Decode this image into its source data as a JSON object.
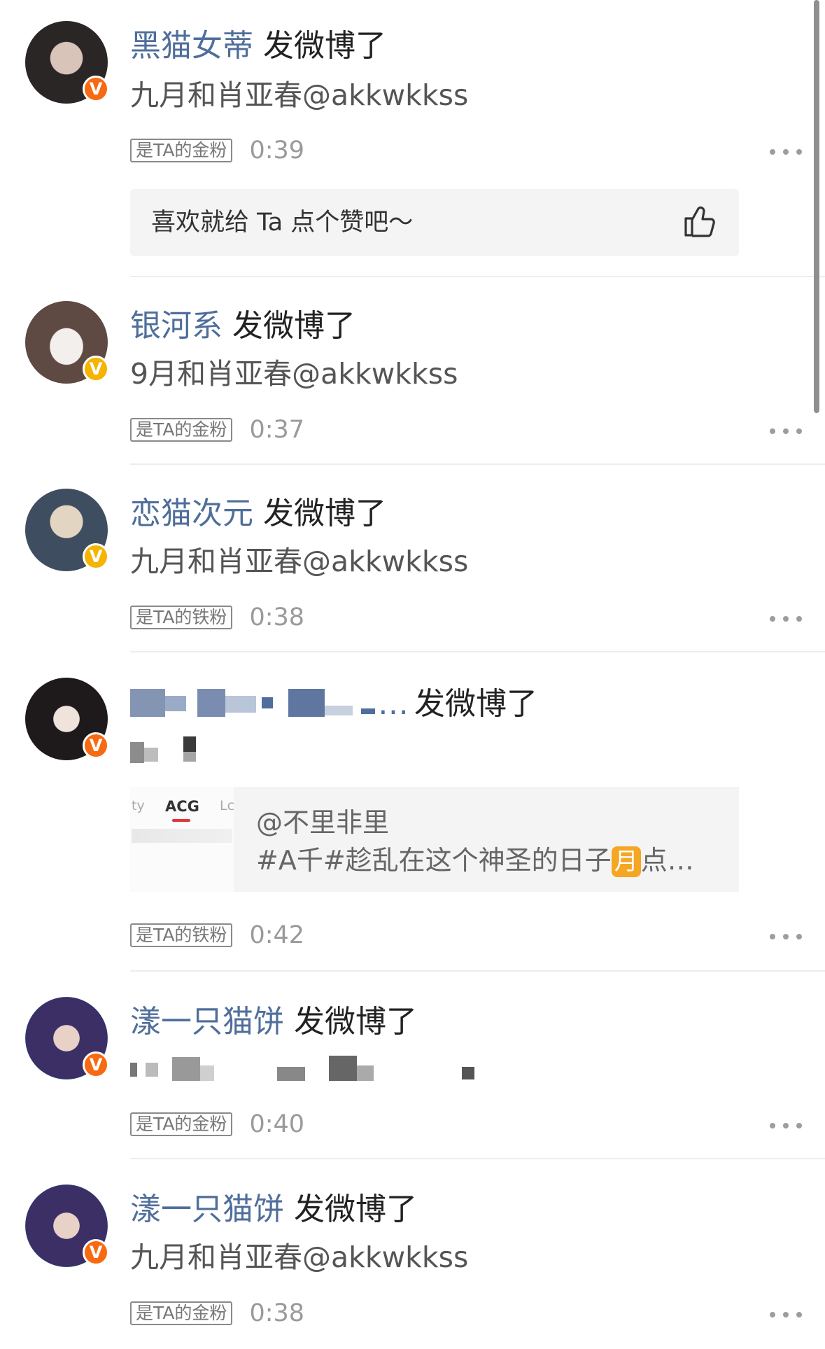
{
  "feed": {
    "items": [
      {
        "username": "黑猫女蒂",
        "action": "发微博了",
        "text": "九月和肖亚春@akkwkkss",
        "fan_tag": "是TA的金粉",
        "time": "0:39",
        "badge": "v",
        "like_prompt": "喜欢就给 Ta 点个赞吧～"
      },
      {
        "username": "银河系",
        "action": "发微博了",
        "text": "9月和肖亚春@akkwkkss",
        "fan_tag": "是TA的金粉",
        "time": "0:37",
        "badge": "v"
      },
      {
        "username": "恋猫次元",
        "action": "发微博了",
        "text": "九月和肖亚春@akkwkkss",
        "fan_tag": "是TA的铁粉",
        "time": "0:38",
        "badge": "v"
      },
      {
        "username_suffix": "…",
        "action": "发微博了",
        "fan_tag": "是TA的铁粉",
        "time": "0:42",
        "badge": "v",
        "repost": {
          "thumb_tab_left": "ty",
          "thumb_tab_active": "ACG",
          "thumb_tab_right": "Lc",
          "mention": "@不里非里",
          "snippet_before": "#A千#趁乱在这个神圣的日子",
          "snippet_emoji": "月",
          "snippet_after": "点…"
        }
      },
      {
        "username": "漾一只猫饼",
        "action": "发微博了",
        "fan_tag": "是TA的金粉",
        "time": "0:40",
        "badge": "v"
      },
      {
        "username": "漾一只猫饼",
        "action": "发微博了",
        "text": "九月和肖亚春@akkwkkss",
        "fan_tag": "是TA的金粉",
        "time": "0:38",
        "badge": "v"
      }
    ]
  },
  "icons": {
    "more": "more-horizontal-icon",
    "like": "thumbs-up-icon",
    "verified": "verified-v-icon"
  },
  "colors": {
    "username": "#4f6e9b",
    "verified_orange": "#f76a12",
    "verified_gold": "#f5b400",
    "separator": "#ededed",
    "card_bg": "#f4f4f4"
  }
}
